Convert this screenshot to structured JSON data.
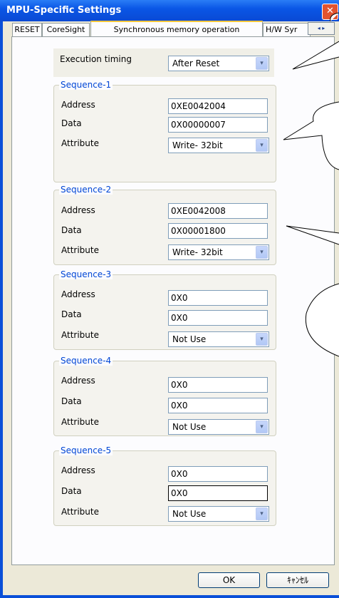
{
  "window": {
    "title": "MPU-Specific Settings",
    "close_glyph": "✕"
  },
  "tabs": [
    {
      "label": "RESET"
    },
    {
      "label": "CoreSight"
    },
    {
      "label": "Synchronous memory operation"
    },
    {
      "label": "H/W Syr"
    }
  ],
  "tab_scroll_glyph": "◂ ▸",
  "execution": {
    "label": "Execution timing",
    "value": "After Reset"
  },
  "field_labels": {
    "address": "Address",
    "data": "Data",
    "attribute": "Attribute"
  },
  "sequences": [
    {
      "title": "Sequence-1",
      "address": "0XE0042004",
      "data": "0X00000007",
      "attribute": "Write- 32bit"
    },
    {
      "title": "Sequence-2",
      "address": "0XE0042008",
      "data": "0X00001800",
      "attribute": "Write- 32bit"
    },
    {
      "title": "Sequence-3",
      "address": "0X0",
      "data": "0X0",
      "attribute": "Not Use"
    },
    {
      "title": "Sequence-4",
      "address": "0X0",
      "data": "0X0",
      "attribute": "Not Use"
    },
    {
      "title": "Sequence-5",
      "address": "0X0",
      "data": "0X0",
      "attribute": "Not Use"
    }
  ],
  "dropdown_glyph": "▾",
  "buttons": {
    "ok": "OK",
    "cancel": "ｷｬﾝｾﾙ"
  }
}
